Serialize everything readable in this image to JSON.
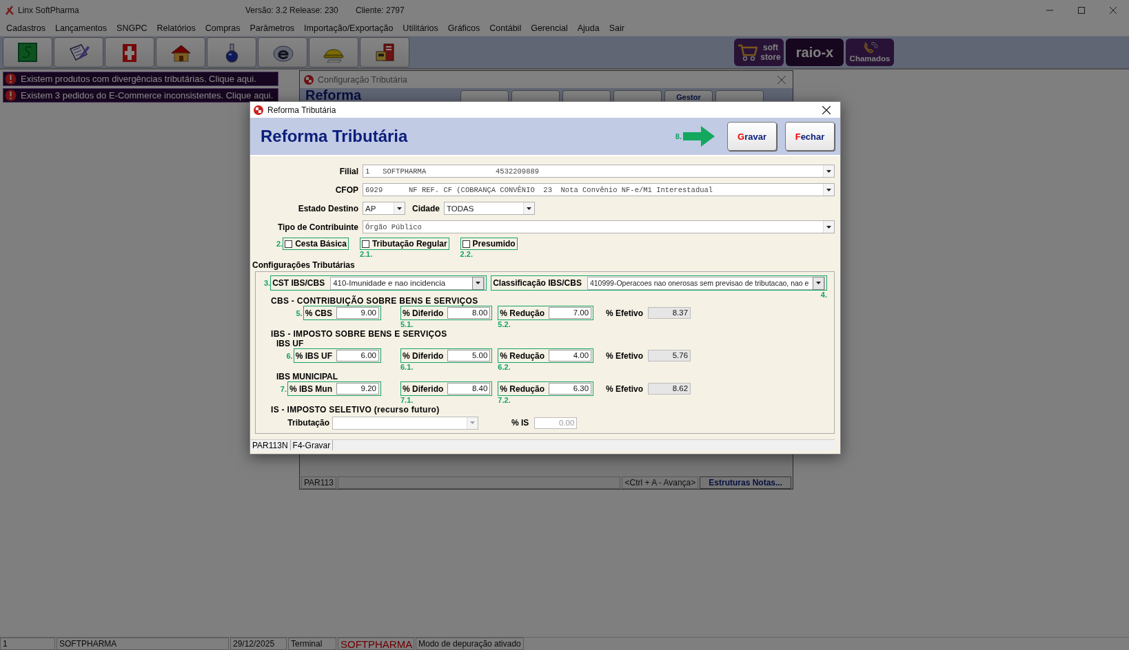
{
  "app": {
    "title": "Linx SoftPharma",
    "version": "Versão: 3.2 Release: 230",
    "client": "Cliente: 2797"
  },
  "menu": [
    "Cadastros",
    "Lançamentos",
    "SNGPC",
    "Relatórios",
    "Compras",
    "Parâmetros",
    "Importação/Exportação",
    "Utilitários",
    "Gráficos",
    "Contábil",
    "Gerencial",
    "Ajuda",
    "Sair"
  ],
  "quick_links": [
    {
      "kind": "store",
      "label": "soft store"
    },
    {
      "kind": "raiox",
      "label": "raio-x"
    },
    {
      "kind": "calls",
      "label": "Chamados"
    }
  ],
  "alerts": [
    "Existem produtos com divergências tributárias. Clique aqui.",
    "Existem 3 pedidos do E-Commerce inconsistentes. Clique aqui."
  ],
  "background_window": {
    "title": "Configuração Tributária",
    "heading": "Reforma",
    "buttons": [
      {
        "kind": "blank"
      },
      {
        "kind": "blank"
      },
      {
        "kind": "blank"
      },
      {
        "kind": "blank"
      },
      {
        "kind": "text",
        "label": "Gestor"
      },
      {
        "kind": "blank"
      }
    ],
    "status": {
      "code": "PAR113",
      "hint": "<Ctrl + A - Avança>",
      "button": "Estruturas Notas..."
    }
  },
  "dialog": {
    "title": "Reforma Tributária",
    "heading": "Reforma Tributária",
    "action_marker": "8.",
    "buttons": [
      {
        "label": "Gravar"
      },
      {
        "label": "Fechar"
      }
    ],
    "filial": {
      "label": "Filial",
      "value": "1   SOFTPHARMA                4532209889"
    },
    "cfop": {
      "label": "CFOP",
      "value": "6929      NF REF. CF (COBRANÇA CONVÊNIO  23  Nota Convênio NF-e/M1 Interestadual"
    },
    "estado": {
      "label": "Estado Destino",
      "value": "AP"
    },
    "cidade": {
      "label": "Cidade",
      "value": "TODAS"
    },
    "tipo": {
      "label": "Tipo de Contribuinte",
      "value": "Órgão Público"
    },
    "checkboxes": [
      {
        "label": "Cesta Básica",
        "checked": false,
        "marker": "2."
      },
      {
        "label": "Tributação Regular",
        "checked": false,
        "marker": "2.1."
      },
      {
        "label": "Presumido",
        "checked": false,
        "marker": "2.2."
      }
    ],
    "section_title": "Configurações Tributárias",
    "cst": {
      "label": "CST IBS/CBS",
      "value": "410-Imunidade e nao incidencia",
      "marker": "3."
    },
    "classificacao": {
      "label": "Classificação IBS/CBS",
      "value": "410999-Operacoes nao onerosas sem previsao de tributacao, nao e",
      "marker": "4."
    },
    "tax_sections": [
      {
        "title": "CBS - CONTRIBUIÇÃO SOBRE BENS E SERVIÇOS",
        "rows": [
          {
            "fields": [
              {
                "label": "% CBS",
                "value": "9.00",
                "marker": "5."
              },
              {
                "label": "% Diferido",
                "value": "8.00",
                "marker": "5.1."
              },
              {
                "label": "% Redução",
                "value": "7.00",
                "marker": "5.2."
              }
            ],
            "effective": {
              "label": "% Efetivo",
              "value": "8.37"
            }
          }
        ]
      },
      {
        "title": "IBS - IMPOSTO SOBRE BENS E SERVIÇOS",
        "rows": [
          {
            "subtitle": "IBS UF",
            "fields": [
              {
                "label": "% IBS UF",
                "value": "6.00",
                "marker": "6."
              },
              {
                "label": "% Diferido",
                "value": "5.00",
                "marker": "6.1."
              },
              {
                "label": "% Redução",
                "value": "4.00",
                "marker": "6.2."
              }
            ],
            "effective": {
              "label": "% Efetivo",
              "value": "5.76"
            }
          },
          {
            "subtitle": "IBS MUNICIPAL",
            "fields": [
              {
                "label": "% IBS Mun",
                "value": "9.20",
                "marker": "7."
              },
              {
                "label": "% Diferido",
                "value": "8.40",
                "marker": "7.1."
              },
              {
                "label": "% Redução",
                "value": "6.30",
                "marker": "7.2."
              }
            ],
            "effective": {
              "label": "% Efetivo",
              "value": "8.62"
            }
          }
        ]
      }
    ],
    "is_section": {
      "title": "IS - IMPOSTO SELETIVO (recurso futuro)",
      "tributacao": {
        "label": "Tributação",
        "disabled": true
      },
      "percent": {
        "label": "% IS",
        "value": "0.00",
        "disabled": true
      }
    },
    "status": [
      "PAR113N",
      "F4-Gravar"
    ]
  },
  "status_bar": [
    {
      "kind": "plain",
      "text": "1"
    },
    {
      "kind": "plain",
      "text": "SOFTPHARMA"
    },
    {
      "kind": "plain",
      "text": "29/12/2025"
    },
    {
      "kind": "plain",
      "text": "Terminal"
    },
    {
      "kind": "brand",
      "text": "SOFTPHARMA"
    },
    {
      "kind": "plain",
      "text": "Modo de depuração ativado"
    }
  ]
}
